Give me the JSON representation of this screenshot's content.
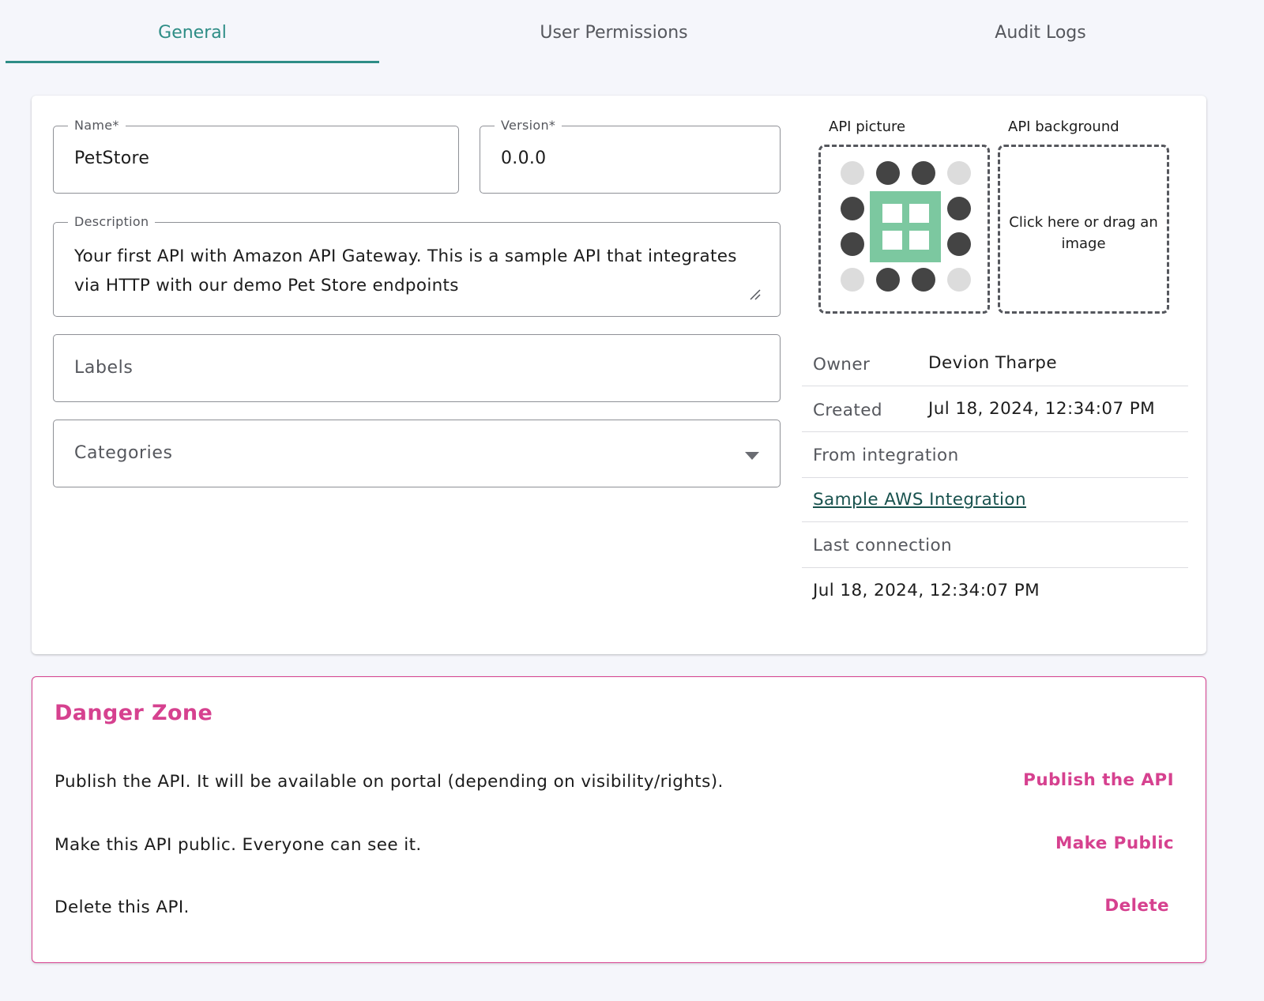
{
  "tabs": [
    {
      "label": "General",
      "active": true
    },
    {
      "label": "User Permissions",
      "active": false
    },
    {
      "label": "Audit Logs",
      "active": false
    }
  ],
  "form": {
    "name_label": "Name*",
    "name_value": "PetStore",
    "version_label": "Version*",
    "version_value": "0.0.0",
    "description_label": "Description",
    "description_value": "Your first API with Amazon API Gateway. This is a sample API that integrates via HTTP with our demo Pet Store endpoints",
    "labels_placeholder": "Labels",
    "categories_placeholder": "Categories"
  },
  "images": {
    "picture_label": "API picture",
    "background_label": "API background",
    "background_hint": "Click here or drag an image"
  },
  "meta": {
    "owner_label": "Owner",
    "owner_value": "Devion Tharpe",
    "created_label": "Created",
    "created_value": "Jul 18, 2024, 12:34:07 PM",
    "integration_label": "From integration",
    "integration_link": "Sample AWS Integration",
    "last_connection_label": "Last connection",
    "last_connection_value": "Jul 18, 2024, 12:34:07 PM"
  },
  "danger": {
    "title": "Danger Zone",
    "publish_text": "Publish the API. It will be available on portal (depending on visibility/rights).",
    "publish_action": "Publish the API",
    "public_text": "Make this API public. Everyone can see it.",
    "public_action": "Make Public",
    "delete_text": "Delete this API.",
    "delete_action": "Delete"
  },
  "colors": {
    "accent": "#2e8d86",
    "danger": "#d6418f",
    "link": "#19524e",
    "avatar_green": "#7cc8a0"
  }
}
